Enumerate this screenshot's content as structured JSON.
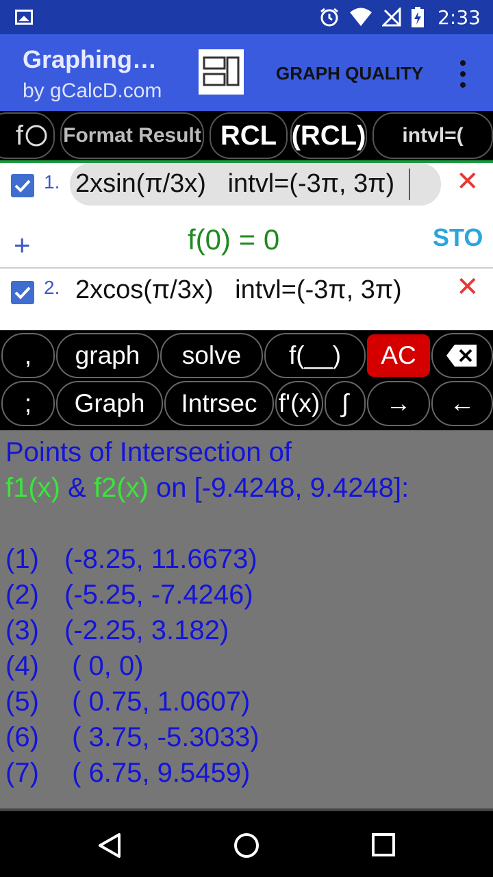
{
  "status_bar": {
    "time": "2:33"
  },
  "app_bar": {
    "title": "Graphing…",
    "subtitle": "by gCalcD.com",
    "graph_quality_label": "GRAPH QUALITY"
  },
  "function_toolbar": {
    "f_label": "f",
    "format_label": "Format Result",
    "rcl_label": "RCL",
    "rcl_paren_label": "(RCL)",
    "intvl_label": "intvl=("
  },
  "functions": [
    {
      "number": "1.",
      "expression": "2xsin(π/3x)   intvl=(-3π, 3π)",
      "checked": true,
      "result": "f(0) = 0",
      "sto_label": "STO"
    },
    {
      "number": "2.",
      "expression": "2xcos(π/3x)   intvl=(-3π, 3π)",
      "checked": true
    }
  ],
  "keypad": {
    "row1": [
      ",",
      "graph",
      "solve",
      "f(__)",
      "AC"
    ],
    "row2": [
      ";",
      "Graph",
      "Intrsec",
      "f'(x)",
      "∫",
      "→",
      "←"
    ]
  },
  "results": {
    "heading1": "Points of Intersection of",
    "f1": "f1(x)",
    "amp": " & ",
    "f2": "f2(x)",
    "range": " on [-9.4248, 9.4248]:",
    "points": [
      {
        "label": "(1)",
        "value": "(-8.25, 11.6673)"
      },
      {
        "label": "(2)",
        "value": "(-5.25, -7.4246)"
      },
      {
        "label": "(3)",
        "value": "(-2.25, 3.182)"
      },
      {
        "label": "(4)",
        "value": " ( 0, 0)"
      },
      {
        "label": "(5)",
        "value": " ( 0.75, 1.0607)"
      },
      {
        "label": "(6)",
        "value": " ( 3.75, -5.3033)"
      },
      {
        "label": "(7)",
        "value": " ( 6.75, 9.5459)"
      }
    ]
  },
  "colors": {
    "app_bar": "#3a5bdd",
    "status_bar": "#1c3aa8",
    "result_text": "#1414d8",
    "function_name": "#39e639",
    "ac_button": "#d40000",
    "sto": "#2aa6dc",
    "close_x": "#e53935"
  }
}
